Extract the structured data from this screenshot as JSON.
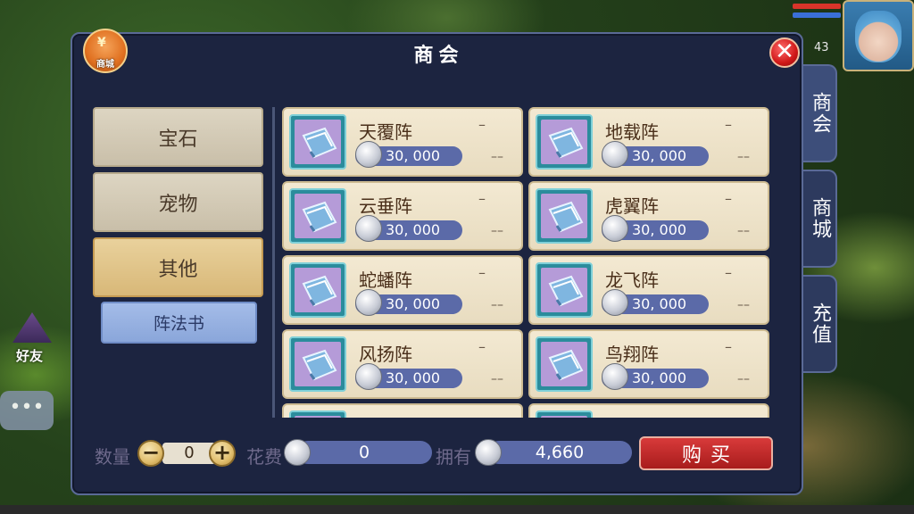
{
  "hud": {
    "level": "43"
  },
  "friend_label": "好友",
  "chat_icon": "•••",
  "panel": {
    "title": "商会",
    "close_icon": "✕"
  },
  "shop_badge": {
    "symbol": "¥",
    "label": "商城"
  },
  "side_tabs": [
    "商会",
    "商城",
    "充值"
  ],
  "categories": [
    "宝石",
    "宠物",
    "其他"
  ],
  "active_category": "其他",
  "subcategory": "阵法书",
  "items": [
    {
      "name": "天覆阵",
      "price": "30, 000",
      "dash1": "–",
      "dash2": "––"
    },
    {
      "name": "地载阵",
      "price": "30, 000",
      "dash1": "–",
      "dash2": "––"
    },
    {
      "name": "云垂阵",
      "price": "30, 000",
      "dash1": "–",
      "dash2": "––"
    },
    {
      "name": "虎翼阵",
      "price": "30, 000",
      "dash1": "–",
      "dash2": "––"
    },
    {
      "name": "蛇蟠阵",
      "price": "30, 000",
      "dash1": "–",
      "dash2": "––"
    },
    {
      "name": "龙飞阵",
      "price": "30, 000",
      "dash1": "–",
      "dash2": "––"
    },
    {
      "name": "风扬阵",
      "price": "30, 000",
      "dash1": "–",
      "dash2": "––"
    },
    {
      "name": "鸟翔阵",
      "price": "30, 000",
      "dash1": "–",
      "dash2": "––"
    },
    {
      "name": "",
      "price": "",
      "dash1": "",
      "dash2": ""
    },
    {
      "name": "",
      "price": "",
      "dash1": "",
      "dash2": ""
    }
  ],
  "footer": {
    "qty_label": "数量",
    "qty_value": "0",
    "cost_label": "花费",
    "cost_value": "0",
    "own_label": "拥有",
    "own_value": "4,660",
    "buy_label": "购买",
    "minus": "−",
    "plus": "+"
  },
  "colors": {
    "panel_bg": "#1c2440",
    "card_bg": "#f3e9d2",
    "price_pill": "#5b6aa8",
    "buy_button": "#c82a2a",
    "active_category": "#e2c688"
  }
}
